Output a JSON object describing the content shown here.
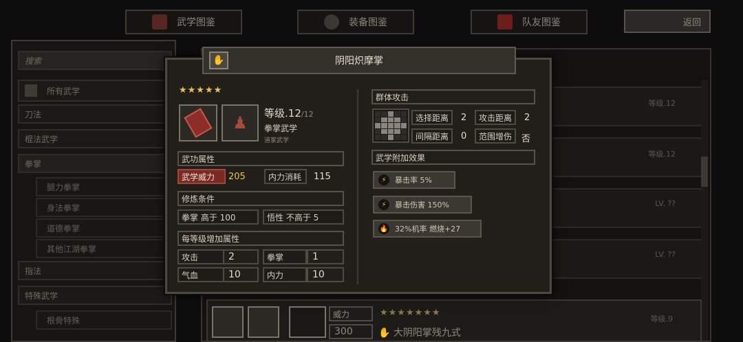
{
  "tabs": [
    {
      "label": "武学图鉴",
      "icon": "book-icon"
    },
    {
      "label": "装备图鉴",
      "icon": "gear-icon"
    },
    {
      "label": "队友图鉴",
      "icon": "demon-mask-icon"
    }
  ],
  "back_label": "返回",
  "sidebar": {
    "search_label": "搜索",
    "items": [
      {
        "label": "所有武学",
        "sub": false
      },
      {
        "label": "刀法",
        "sub": false
      },
      {
        "label": "棍法武学",
        "sub": false
      },
      {
        "label": "拳掌",
        "sub": false
      },
      {
        "label": "腿力拳掌",
        "sub": true
      },
      {
        "label": "身法拳掌",
        "sub": true
      },
      {
        "label": "道德拳掌",
        "sub": true
      },
      {
        "label": "其他江湖拳掌",
        "sub": true
      },
      {
        "label": "指法",
        "sub": false
      },
      {
        "label": "特殊武学",
        "sub": false
      },
      {
        "label": "根骨特殊",
        "sub": true
      }
    ]
  },
  "background_list": {
    "rows": [
      {
        "level": "等级.12"
      },
      {
        "level": "等级.12"
      },
      {
        "level": "LV. ??"
      },
      {
        "level": "LV. ??"
      }
    ],
    "bottom_row": {
      "power_label": "威力",
      "power_value": "300",
      "stars": "★★★★★★★",
      "name": "大阴阳掌残九式",
      "level": "等级.9"
    }
  },
  "skill": {
    "name": "阴阳炽摩掌",
    "stars": "★★★★★",
    "level_label": "等级",
    "level_current": ".12",
    "level_max": "/12",
    "type": "拳掌武学",
    "school": "道家武学",
    "attr_header": "武功属性",
    "power_label": "武学威力",
    "power_value": "205",
    "mp_label": "内力消耗",
    "mp_value": "115",
    "req_header": "修炼条件",
    "req": [
      {
        "text": "拳掌 高于 100"
      },
      {
        "text": "悟性 不高于 5"
      }
    ],
    "growth_header": "每等级增加属性",
    "growth": [
      {
        "label": "攻击",
        "value": "2"
      },
      {
        "label": "拳掌",
        "value": "1"
      },
      {
        "label": "气血",
        "value": "10"
      },
      {
        "label": "内力",
        "value": "10"
      }
    ],
    "target_header": "群体攻击",
    "range": [
      {
        "label": "选择距离",
        "value": "2"
      },
      {
        "label": "攻击距离",
        "value": "2"
      },
      {
        "label": "间隔距离",
        "value": "0"
      },
      {
        "label": "范围增伤",
        "value": "否"
      }
    ],
    "effects_header": "武学附加效果",
    "effects": [
      {
        "text": "暴击率 5%",
        "icon": "lightning-icon",
        "color": "#e8c34a"
      },
      {
        "text": "暴击伤害 150%",
        "icon": "lightning-icon",
        "color": "#e8c34a"
      },
      {
        "text": "32%机率 燃烧+27",
        "icon": "fire-icon",
        "color": "#d9452e"
      }
    ]
  }
}
